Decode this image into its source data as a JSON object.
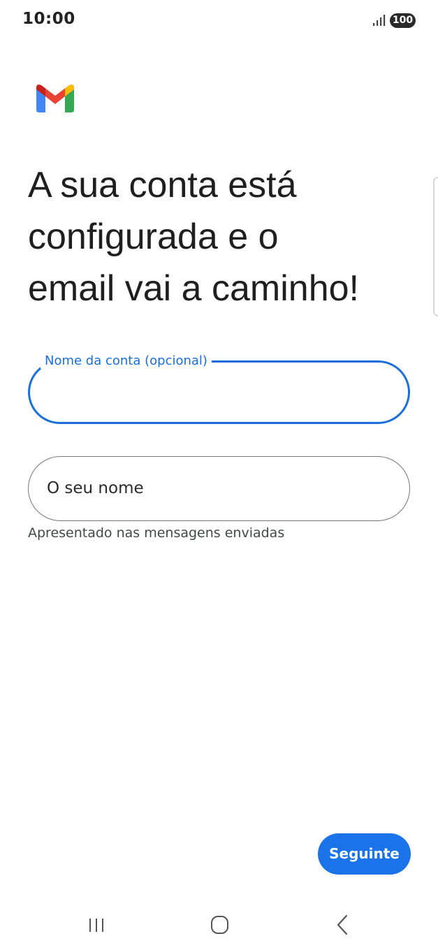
{
  "status_bar": {
    "time": "10:00",
    "battery": "100",
    "signal_icon": "signal-bars-icon"
  },
  "logo": {
    "icon": "gmail-logo-icon",
    "colors": {
      "blue": "#4285F4",
      "red": "#EA4335",
      "yellow": "#FBBC04",
      "green": "#34A853",
      "dark_red": "#C5221F"
    }
  },
  "heading": {
    "line1": "A sua conta está",
    "line2": "configurada e o",
    "line3": "email vai a caminho!"
  },
  "account_name_field": {
    "label": "Nome da conta (opcional)",
    "value": "",
    "state": "focused"
  },
  "your_name_field": {
    "placeholder": "O seu nome",
    "value": "",
    "helper": "Apresentado nas mensagens enviadas"
  },
  "next_button": {
    "label": "Seguinte"
  },
  "nav_bar": {
    "recent_icon": "recent-apps-icon",
    "home_icon": "home-icon",
    "back_icon": "back-icon"
  },
  "theme": {
    "accent": "#1A73E8",
    "focus_outline": "#1A6FD8",
    "outline": "#747775"
  }
}
